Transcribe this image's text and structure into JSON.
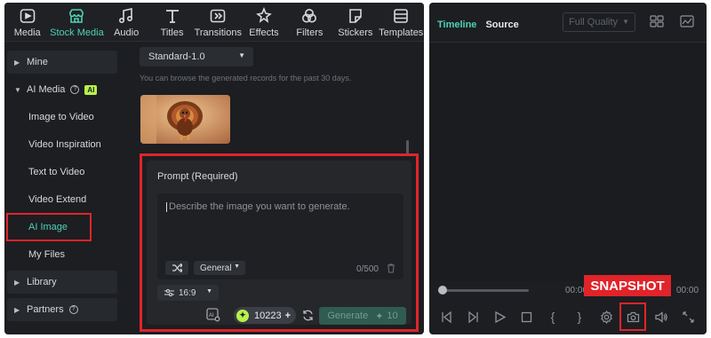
{
  "toolbar": {
    "items": [
      {
        "label": "Media",
        "icon": "media-icon",
        "active": false
      },
      {
        "label": "Stock Media",
        "icon": "stock-media-icon",
        "active": true
      },
      {
        "label": "Audio",
        "icon": "music-note-icon",
        "active": false
      },
      {
        "label": "Titles",
        "icon": "text-t-icon",
        "active": false
      },
      {
        "label": "Transitions",
        "icon": "transition-icon",
        "active": false
      },
      {
        "label": "Effects",
        "icon": "sparkle-icon",
        "active": false
      },
      {
        "label": "Filters",
        "icon": "filters-icon",
        "active": false
      },
      {
        "label": "Stickers",
        "icon": "sticker-icon",
        "active": false
      },
      {
        "label": "Templates",
        "icon": "templates-icon",
        "active": false
      }
    ],
    "accent": "#4fd1b5"
  },
  "sidebar": {
    "mine": "Mine",
    "ai_media": "AI Media",
    "ai_badge": "AI",
    "items": [
      "Image to Video",
      "Video Inspiration",
      "Text to Video",
      "Video Extend",
      "AI Image",
      "My Files"
    ],
    "selected": "AI Image",
    "library": "Library",
    "partners": "Partners"
  },
  "main": {
    "model": "Standard-1.0",
    "browse_note": "You can browse the generated records for the past 30 days.",
    "prompt_title": "Prompt (Required)",
    "prompt_placeholder": "Describe the image you want to generate.",
    "style": "General",
    "char_count": "0/500",
    "ratio": "16:9",
    "credits": "10223",
    "generate_label": "Generate",
    "generate_cost": "10"
  },
  "right": {
    "tabs": [
      "Timeline",
      "Source"
    ],
    "active_tab": "Timeline",
    "quality": "Full Quality",
    "time_left": "00:00",
    "time_right": "00:00",
    "snapshot_label": "SNAPSHOT"
  },
  "colors": {
    "highlight": "#e0242a",
    "panel": "#1c1e22",
    "accent": "#4fd1b5",
    "ai_badge": "#b7f24a"
  }
}
